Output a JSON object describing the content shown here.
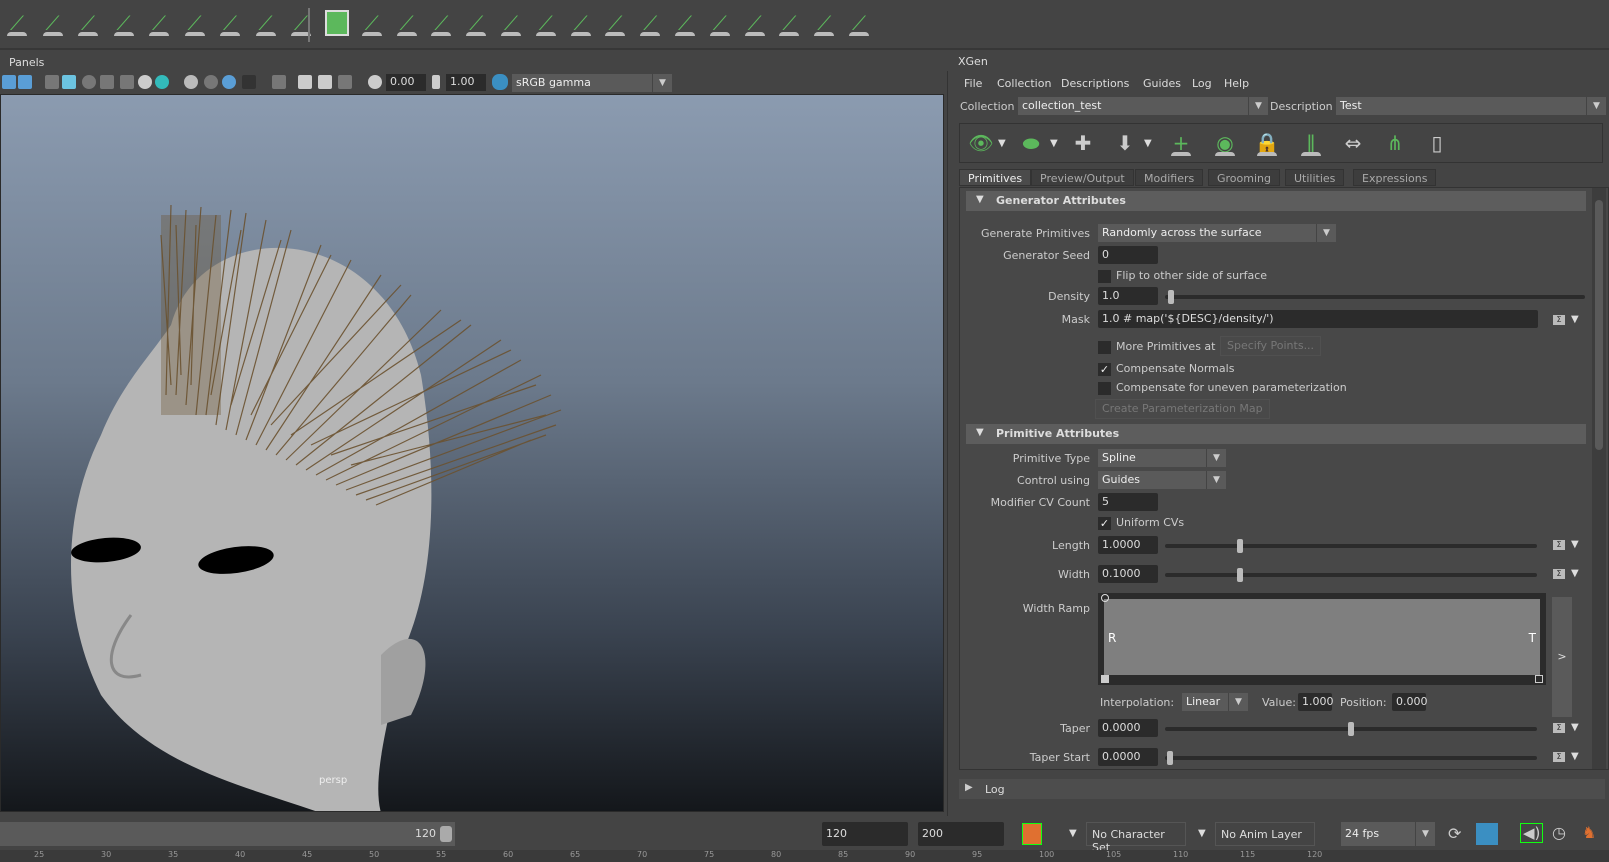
{
  "shelf": {
    "icons": [
      "xgen-eye-icon",
      "lock-guide-icon",
      "guides-icon",
      "density-brush-icon",
      "flip-guides-icon",
      "select-guides-icon",
      "bounding-icon",
      "delete-guides-icon",
      "export-guides-icon",
      "grass-preview-icon",
      "add-primitive-icon",
      "brush-grass-icon",
      "scatter-brush-icon",
      "groom-brush-1-icon",
      "groom-brush-2-icon",
      "groom-brush-3-icon",
      "twist-brush-icon",
      "comb-brush-icon",
      "cut-brush-icon",
      "noise-brush-icon",
      "clump-brush-icon",
      "part-brush-icon",
      "smooth-brush-icon",
      "freeze-brush-icon",
      "select-brush-icon"
    ]
  },
  "viewport": {
    "panels_menu": "Panels",
    "exposure": "0.00",
    "gamma": "1.00",
    "color_space": "sRGB gamma",
    "camera_label": "persp"
  },
  "xgen": {
    "tab": "XGen",
    "menu": [
      "File",
      "Collection",
      "Descriptions",
      "Guides",
      "Log",
      "Help"
    ],
    "collection_label": "Collection",
    "collection_value": "collection_test",
    "description_label": "Description",
    "description_value": "Test",
    "tabs": [
      "Primitives",
      "Preview/Output",
      "Modifiers",
      "Grooming",
      "Utilities",
      "Expressions"
    ],
    "generator": {
      "title": "Generator Attributes",
      "generate_label": "Generate Primitives",
      "generate_value": "Randomly across the surface",
      "seed_label": "Generator Seed",
      "seed_value": "0",
      "flip_label": "Flip to other side of surface",
      "flip_checked": false,
      "density_label": "Density",
      "density_value": "1.0",
      "mask_label": "Mask",
      "mask_value": "1.0 # map('${DESC}/density/')",
      "more_label": "More Primitives at",
      "more_checked": false,
      "specify_button": "Specify Points...",
      "comp_normals_label": "Compensate Normals",
      "comp_normals_checked": true,
      "check_mark": "✓",
      "comp_uneven_label": "Compensate for uneven parameterization",
      "comp_uneven_checked": false,
      "create_map_button": "Create Parameterization Map"
    },
    "primitive": {
      "title": "Primitive Attributes",
      "type_label": "Primitive Type",
      "type_value": "Spline",
      "control_label": "Control using",
      "control_value": "Guides",
      "cv_label": "Modifier CV Count",
      "cv_value": "5",
      "uniform_label": "Uniform CVs",
      "uniform_checked": true,
      "length_label": "Length",
      "length_value": "1.0000",
      "width_label": "Width",
      "width_value": "0.1000",
      "ramp_label": "Width Ramp",
      "ramp_left": "R",
      "ramp_right": "T",
      "ramp_expand": ">",
      "interp_label": "Interpolation:",
      "interp_value": "Linear",
      "value_label": "Value:",
      "value_value": "1.000",
      "position_label": "Position:",
      "position_value": "0.000",
      "taper_label": "Taper",
      "taper_value": "0.0000",
      "taper_start_label": "Taper Start",
      "taper_start_value": "0.0000"
    },
    "log_label": "Log"
  },
  "timeline": {
    "current_frame": "120",
    "range_start": "120",
    "range_end": "200",
    "character_set": "No Character Set",
    "anim_layer": "No Anim Layer",
    "fps": "24 fps"
  },
  "ruler": [
    "25",
    "30",
    "35",
    "40",
    "45",
    "50",
    "55",
    "60",
    "65",
    "70",
    "75",
    "80",
    "85",
    "90",
    "95",
    "100",
    "105",
    "110",
    "115",
    "120"
  ]
}
